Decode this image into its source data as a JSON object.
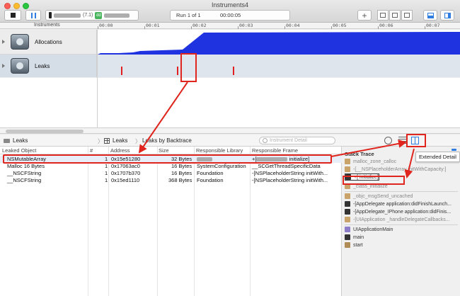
{
  "window": {
    "title": "Instruments4"
  },
  "toolbar": {
    "target_version": "(7.1)",
    "app_badge": "dd",
    "run_label": "Run 1 of 1",
    "time_label": "00:00:05",
    "add_label": "+"
  },
  "timeline": {
    "column_header": "Instruments",
    "ruler_ticks": [
      "00:00",
      "00:01",
      "00:02",
      "00:03",
      "00:04",
      "00:05",
      "00:06",
      "00:07"
    ],
    "tracks": [
      {
        "name": "Allocations"
      },
      {
        "name": "Leaks"
      }
    ],
    "leak_spikes_seconds": [
      0.5,
      1.7,
      2.9
    ],
    "allocation_color": "#1f34e0",
    "selected_track_color": "#d5dde7"
  },
  "detail_nav": {
    "crumb1": "Leaks",
    "crumb2": "Leaks",
    "crumb3": "Leaks by Backtrace",
    "search_placeholder": "Instrument Detail"
  },
  "table": {
    "columns": [
      "Leaked Object",
      "#",
      "Address",
      "Size",
      "Responsible Library",
      "Responsible Frame"
    ],
    "rows": [
      {
        "object": "NSMutableArray",
        "count": "1",
        "address": "0x15e51280",
        "size": "32 Bytes",
        "library": "",
        "frame": "+[ initialize]"
      },
      {
        "object": "Malloc 16 Bytes",
        "count": "1",
        "address": "0x17063ac0",
        "size": "16 Bytes",
        "library": "SystemConfiguration",
        "frame": "__SCGetThreadSpecificData"
      },
      {
        "object": "__NSCFString",
        "count": "1",
        "address": "0x1707b370",
        "size": "16 Bytes",
        "library": "Foundation",
        "frame": "-[NSPlaceholderString initWith..."
      },
      {
        "object": "__NSCFString",
        "count": "1",
        "address": "0x15ed1110",
        "size": "368 Bytes",
        "library": "Foundation",
        "frame": "-[NSPlaceholderString initWith..."
      }
    ]
  },
  "extended_detail": {
    "tooltip": "Extended Detail",
    "stack_title": "Stack Trace",
    "frames": [
      {
        "label": "malloc_zone_calloc",
        "kind": "sys",
        "dim": true
      },
      {
        "label": "-[__NSPlaceholderArray initWithCapacity:]",
        "kind": "sys",
        "dim": true
      },
      {
        "label": "+[ initialize]",
        "kind": "user",
        "dim": false,
        "selected": true
      },
      {
        "label": "_class_initialize",
        "kind": "sys",
        "dim": true
      },
      {
        "label": "_objc_msgSend_uncached",
        "kind": "sys",
        "dim": true
      },
      {
        "label": "-[AppDelegate application:didFinishLaunch...",
        "kind": "user",
        "dim": false
      },
      {
        "label": "-[AppDelegate_IPhone application:didFinis...",
        "kind": "user",
        "dim": false
      },
      {
        "label": "-[UIApplication _handleDelegateCallbacks...",
        "kind": "sys",
        "dim": true
      },
      {
        "label": "UIApplicationMain",
        "kind": "ui",
        "dim": false
      },
      {
        "label": "main",
        "kind": "user",
        "dim": false
      },
      {
        "label": "start",
        "kind": "lib",
        "dim": false
      }
    ]
  },
  "annotation_color": "#e0251e"
}
